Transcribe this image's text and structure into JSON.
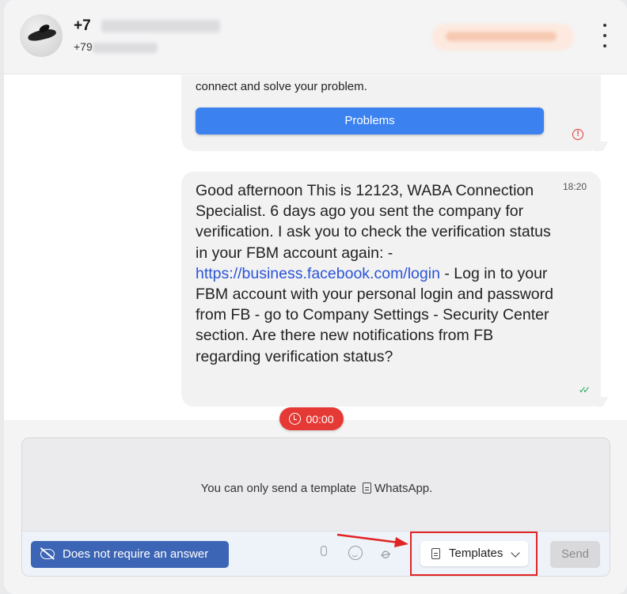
{
  "header": {
    "phone_main": "+7",
    "phone_sub": "+79",
    "menu_icon": "more-vertical-icon"
  },
  "messages": [
    {
      "text": "connect and solve your problem.",
      "button_label": "Problems",
      "status_icon": "error-icon",
      "status_color": "#e53935"
    },
    {
      "time": "18:20",
      "text_before_link": "Good afternoon This is 12123, WABA Connection Specialist. 6 days ago you sent the company for verification. I ask you to check the verification status in your FBM account again: - ",
      "link": "https://business.facebook.com/login",
      "text_after_link": " - Log in to your FBM account with your personal login and password from FB - go to Company Settings - Security Center section. Are there new notifications from FB regarding verification status?",
      "status_icon": "double-check-icon",
      "status_color": "#22a85a"
    }
  ],
  "timer": {
    "value": "00:00",
    "color": "#e53935"
  },
  "composer": {
    "notice_text": "You can only send a template",
    "notice_channel": "WhatsApp.",
    "no_answer_label": "Does not require an answer",
    "templates_label": "Templates",
    "send_label": "Send"
  },
  "colors": {
    "accent_blue": "#3b82f0",
    "no_answer_blue": "#3d65b5",
    "highlight_red": "#e02424"
  }
}
